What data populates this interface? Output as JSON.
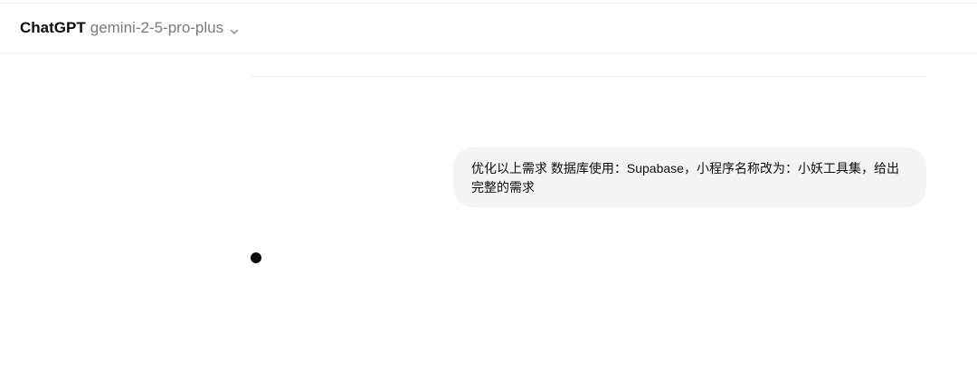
{
  "header": {
    "brand": "ChatGPT",
    "model": "gemini-2-5-pro-plus",
    "chevron_icon": "chevron-down-icon"
  },
  "conversation": {
    "user_message": "优化以上需求 数据库使用：Supabase，小程序名称改为：小妖工具集，给出完整的需求"
  },
  "colors": {
    "bubble_background": "#f4f4f4",
    "model_name_text": "#7a7a7a",
    "text": "#0d0d0d"
  }
}
